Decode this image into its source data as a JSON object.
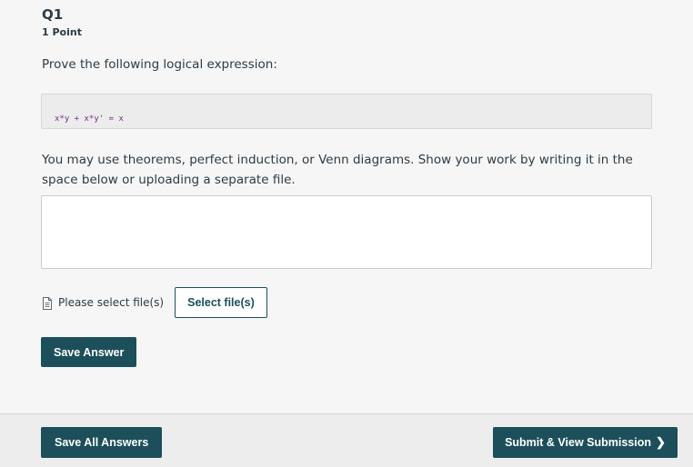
{
  "question": {
    "title": "Q1",
    "points": "1 Point",
    "prompt": "Prove the following logical expression:",
    "expression": "x*y + x*y' = x",
    "instructions": "You may use theorems, perfect induction, or Venn diagrams.  Show your work by writing it in the space below or uploading a separate file.",
    "answer_value": ""
  },
  "upload": {
    "icon": "file-icon",
    "label": "Please select file(s)",
    "button_label": "Select file(s)"
  },
  "actions": {
    "save_answer": "Save Answer"
  },
  "footer": {
    "save_all": "Save All Answers",
    "submit": "Submit & View Submission",
    "submit_icon": "chevron-right-icon"
  },
  "colors": {
    "primary": "#1c4f5a",
    "code_text": "#7a2d8a",
    "background": "#f6f6f6"
  }
}
